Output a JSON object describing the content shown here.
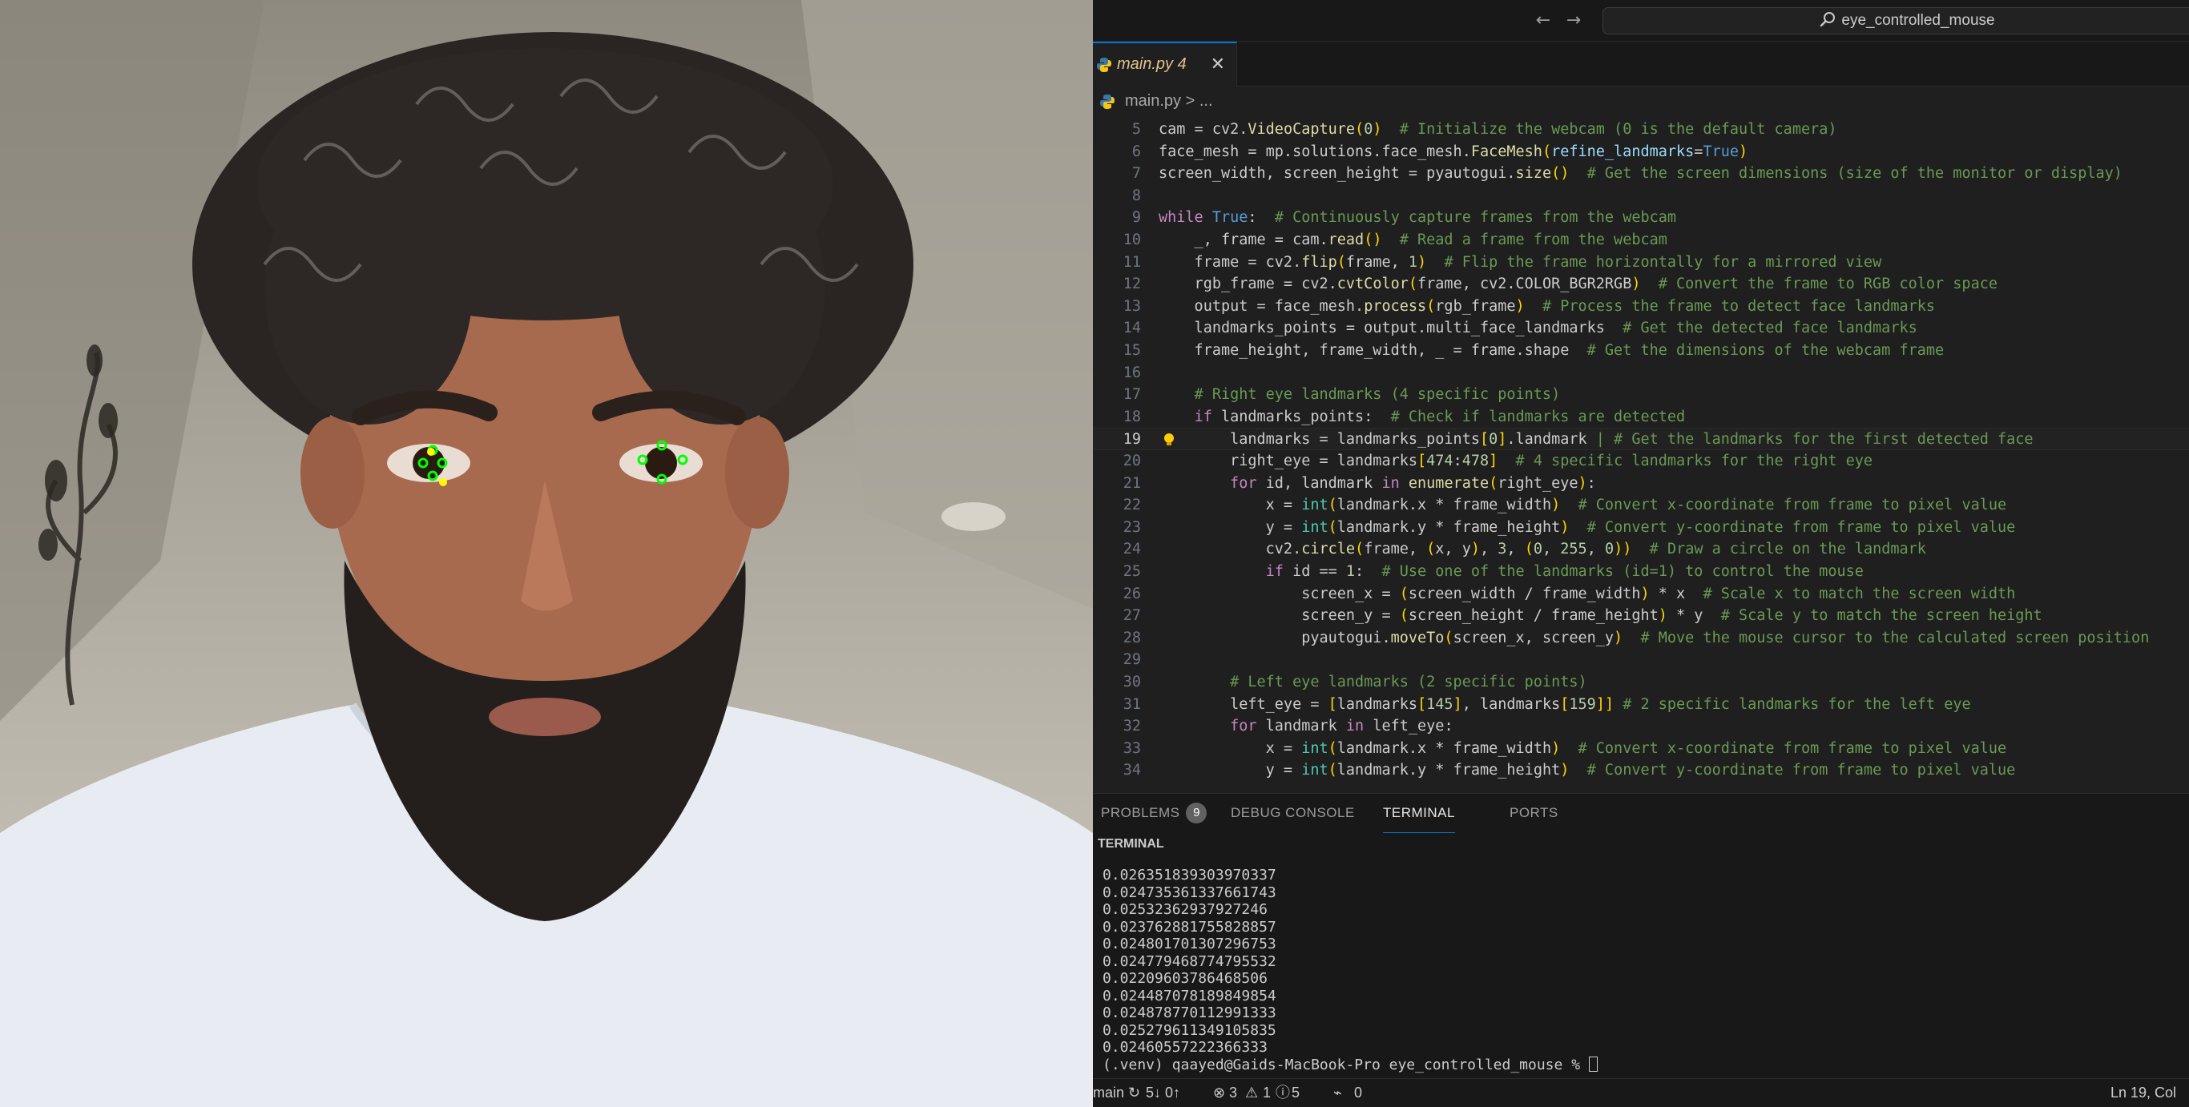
{
  "titlebar": {
    "back_icon": "arrow-left-icon",
    "forward_icon": "arrow-right-icon",
    "search_icon": "search-icon",
    "search_text": "eye_controlled_mouse"
  },
  "tab": {
    "label": "main.py 4",
    "icon": "python-file-icon",
    "close_icon": "close-icon"
  },
  "breadcrumb": {
    "file": "main.py",
    "separator": ">",
    "rest": "..."
  },
  "code_lines": [
    {
      "n": "5",
      "segs": [
        [
          "cam = cv2.",
          "t"
        ],
        [
          "VideoCapture",
          "f"
        ],
        [
          "(",
          "b"
        ],
        [
          "0",
          "n"
        ],
        [
          ")",
          "b"
        ],
        [
          "  # Initialize the webcam (0 is the default camera)",
          "c"
        ]
      ]
    },
    {
      "n": "6",
      "segs": [
        [
          "face_mesh = mp.solutions.face_mesh.",
          "t"
        ],
        [
          "FaceMesh",
          "f"
        ],
        [
          "(",
          "b"
        ],
        [
          "refine_landmarks",
          "p"
        ],
        [
          "=",
          "t"
        ],
        [
          "True",
          "kb"
        ],
        [
          ")",
          "b"
        ]
      ]
    },
    {
      "n": "7",
      "segs": [
        [
          "screen_width, screen_height = pyautogui.",
          "t"
        ],
        [
          "size",
          "f"
        ],
        [
          "()",
          "b"
        ],
        [
          "  # Get the screen dimensions (size of the monitor or display)",
          "c"
        ]
      ]
    },
    {
      "n": "8",
      "segs": []
    },
    {
      "n": "9",
      "segs": [
        [
          "while",
          "k"
        ],
        [
          " ",
          "t"
        ],
        [
          "True",
          "kb"
        ],
        [
          ":  ",
          "t"
        ],
        [
          "# Continuously capture frames from the webcam",
          "c"
        ]
      ]
    },
    {
      "n": "10",
      "segs": [
        [
          "    _, frame = cam.",
          "t"
        ],
        [
          "read",
          "f"
        ],
        [
          "()",
          "b"
        ],
        [
          "  # Read a frame from the webcam",
          "c"
        ]
      ]
    },
    {
      "n": "11",
      "segs": [
        [
          "    frame = cv2.",
          "t"
        ],
        [
          "flip",
          "f"
        ],
        [
          "(",
          "b"
        ],
        [
          "frame, ",
          "t"
        ],
        [
          "1",
          "n"
        ],
        [
          ")",
          "b"
        ],
        [
          "  # Flip the frame horizontally for a mirrored view",
          "c"
        ]
      ]
    },
    {
      "n": "12",
      "segs": [
        [
          "    rgb_frame = cv2.",
          "t"
        ],
        [
          "cvtColor",
          "f"
        ],
        [
          "(",
          "b"
        ],
        [
          "frame, cv2.COLOR_BGR2RGB",
          "t"
        ],
        [
          ")",
          "b"
        ],
        [
          "  # Convert the frame to RGB color space",
          "c"
        ]
      ]
    },
    {
      "n": "13",
      "segs": [
        [
          "    output = face_mesh.",
          "t"
        ],
        [
          "process",
          "f"
        ],
        [
          "(",
          "b"
        ],
        [
          "rgb_frame",
          "t"
        ],
        [
          ")",
          "b"
        ],
        [
          "  # Process the frame to detect face landmarks",
          "c"
        ]
      ]
    },
    {
      "n": "14",
      "segs": [
        [
          "    landmarks_points = output.multi_face_landmarks",
          "t"
        ],
        [
          "  # Get the detected face landmarks",
          "c"
        ]
      ]
    },
    {
      "n": "15",
      "segs": [
        [
          "    frame_height, frame_width, _ = frame.shape",
          "t"
        ],
        [
          "  # Get the dimensions of the webcam frame",
          "c"
        ]
      ]
    },
    {
      "n": "16",
      "segs": []
    },
    {
      "n": "17",
      "segs": [
        [
          "    # Right eye landmarks (4 specific points)",
          "c"
        ]
      ]
    },
    {
      "n": "18",
      "segs": [
        [
          "    ",
          "t"
        ],
        [
          "if",
          "k"
        ],
        [
          " landmarks_points:  ",
          "t"
        ],
        [
          "# Check if landmarks are detected",
          "c"
        ]
      ]
    },
    {
      "n": "19",
      "current": true,
      "segs": [
        [
          "        landmarks = landmarks_points",
          "t"
        ],
        [
          "[",
          "b"
        ],
        [
          "0",
          "n"
        ],
        [
          "]",
          "b"
        ],
        [
          ".landmark ",
          "t"
        ],
        [
          "| # Get the landmarks for the first detected face",
          "c"
        ]
      ]
    },
    {
      "n": "20",
      "segs": [
        [
          "        right_eye = landmarks",
          "t"
        ],
        [
          "[",
          "b"
        ],
        [
          "474",
          "n"
        ],
        [
          ":",
          "t"
        ],
        [
          "478",
          "n"
        ],
        [
          "]",
          "b"
        ],
        [
          "  # 4 specific landmarks for the right eye",
          "c"
        ]
      ]
    },
    {
      "n": "21",
      "segs": [
        [
          "        ",
          "t"
        ],
        [
          "for",
          "k"
        ],
        [
          " id, landmark ",
          "t"
        ],
        [
          "in",
          "k"
        ],
        [
          " ",
          "t"
        ],
        [
          "enumerate",
          "f"
        ],
        [
          "(",
          "b"
        ],
        [
          "right_eye",
          "t"
        ],
        [
          ")",
          "b"
        ],
        [
          ":",
          "t"
        ]
      ]
    },
    {
      "n": "22",
      "segs": [
        [
          "            x = ",
          "t"
        ],
        [
          "int",
          "s"
        ],
        [
          "(",
          "b"
        ],
        [
          "landmark.x * frame_width",
          "t"
        ],
        [
          ")",
          "b"
        ],
        [
          "  # Convert x-coordinate from frame to pixel value",
          "c"
        ]
      ]
    },
    {
      "n": "23",
      "segs": [
        [
          "            y = ",
          "t"
        ],
        [
          "int",
          "s"
        ],
        [
          "(",
          "b"
        ],
        [
          "landmark.y * frame_height",
          "t"
        ],
        [
          ")",
          "b"
        ],
        [
          "  # Convert y-coordinate from frame to pixel value",
          "c"
        ]
      ]
    },
    {
      "n": "24",
      "segs": [
        [
          "            cv2.",
          "t"
        ],
        [
          "circle",
          "f"
        ],
        [
          "(",
          "b"
        ],
        [
          "frame, ",
          "t"
        ],
        [
          "(",
          "b"
        ],
        [
          "x, y",
          "t"
        ],
        [
          ")",
          "b"
        ],
        [
          ", ",
          "t"
        ],
        [
          "3",
          "n"
        ],
        [
          ", ",
          "t"
        ],
        [
          "(",
          "b"
        ],
        [
          "0",
          "n"
        ],
        [
          ", ",
          "t"
        ],
        [
          "255",
          "n"
        ],
        [
          ", ",
          "t"
        ],
        [
          "0",
          "n"
        ],
        [
          ")",
          "b"
        ],
        [
          ")",
          "b"
        ],
        [
          "  # Draw a circle on the landmark",
          "c"
        ]
      ]
    },
    {
      "n": "25",
      "segs": [
        [
          "            ",
          "t"
        ],
        [
          "if",
          "k"
        ],
        [
          " id == ",
          "t"
        ],
        [
          "1",
          "n"
        ],
        [
          ":  ",
          "t"
        ],
        [
          "# Use one of the landmarks (id=1) to control the mouse",
          "c"
        ]
      ]
    },
    {
      "n": "26",
      "segs": [
        [
          "                screen_x = ",
          "t"
        ],
        [
          "(",
          "b"
        ],
        [
          "screen_width / frame_width",
          "t"
        ],
        [
          ")",
          "b"
        ],
        [
          " * x  ",
          "t"
        ],
        [
          "# Scale x to match the screen width",
          "c"
        ]
      ]
    },
    {
      "n": "27",
      "segs": [
        [
          "                screen_y = ",
          "t"
        ],
        [
          "(",
          "b"
        ],
        [
          "screen_height / frame_height",
          "t"
        ],
        [
          ")",
          "b"
        ],
        [
          " * y  ",
          "t"
        ],
        [
          "# Scale y to match the screen height",
          "c"
        ]
      ]
    },
    {
      "n": "28",
      "segs": [
        [
          "                pyautogui.",
          "t"
        ],
        [
          "moveTo",
          "f"
        ],
        [
          "(",
          "b"
        ],
        [
          "screen_x, screen_y",
          "t"
        ],
        [
          ")",
          "b"
        ],
        [
          "  # Move the mouse cursor to the calculated screen position",
          "c"
        ]
      ]
    },
    {
      "n": "29",
      "segs": []
    },
    {
      "n": "30",
      "segs": [
        [
          "        # Left eye landmarks (2 specific points)",
          "c"
        ]
      ]
    },
    {
      "n": "31",
      "segs": [
        [
          "        left_eye = ",
          "t"
        ],
        [
          "[",
          "b"
        ],
        [
          "landmarks",
          "t"
        ],
        [
          "[",
          "b"
        ],
        [
          "145",
          "n"
        ],
        [
          "]",
          "b"
        ],
        [
          ", landmarks",
          "t"
        ],
        [
          "[",
          "b"
        ],
        [
          "159",
          "n"
        ],
        [
          "]",
          "b"
        ],
        [
          "]",
          "b"
        ],
        [
          " # 2 specific landmarks for the left eye",
          "c"
        ]
      ]
    },
    {
      "n": "32",
      "segs": [
        [
          "        ",
          "t"
        ],
        [
          "for",
          "k"
        ],
        [
          " landmark ",
          "t"
        ],
        [
          "in",
          "k"
        ],
        [
          " left_eye:",
          "t"
        ]
      ]
    },
    {
      "n": "33",
      "segs": [
        [
          "            x = ",
          "t"
        ],
        [
          "int",
          "s"
        ],
        [
          "(",
          "b"
        ],
        [
          "landmark.x * frame_width",
          "t"
        ],
        [
          ")",
          "b"
        ],
        [
          "  # Convert x-coordinate from frame to pixel value",
          "c"
        ]
      ]
    },
    {
      "n": "34",
      "segs": [
        [
          "            y = ",
          "t"
        ],
        [
          "int",
          "s"
        ],
        [
          "(",
          "b"
        ],
        [
          "landmark.y * frame_height",
          "t"
        ],
        [
          ")",
          "b"
        ],
        [
          "  # Convert y-coordinate from frame to pixel value",
          "c"
        ]
      ]
    }
  ],
  "panel": {
    "tabs": [
      {
        "label": "PROBLEMS",
        "badge": "9"
      },
      {
        "label": "DEBUG CONSOLE"
      },
      {
        "label": "TERMINAL",
        "active": true
      },
      {
        "label": "PORTS"
      }
    ],
    "terminal_header": "TERMINAL",
    "terminal_lines": [
      "0.026351839303970337",
      "0.024735361337661743",
      "0.02532362937927246",
      "0.023762881755828857",
      "0.024801701307296753",
      "0.024779468774795532",
      "0.02209603786468506",
      "0.024487078189849854",
      "0.024878770112991333",
      "0.025279611349105835",
      "0.02460557222366333"
    ],
    "prompt": "(.venv) qaayed@Gaids-MacBook-Pro eye_controlled_mouse % "
  },
  "statusbar": {
    "branch": "main",
    "sync": "5↓ 0↑",
    "sync_icon": "sync-icon",
    "errors": "3",
    "warnings": "1",
    "infos": "5",
    "ports": "0",
    "position": "Ln 19, Col"
  },
  "landmark_color": "#00ff00",
  "accent": "#0078d4"
}
